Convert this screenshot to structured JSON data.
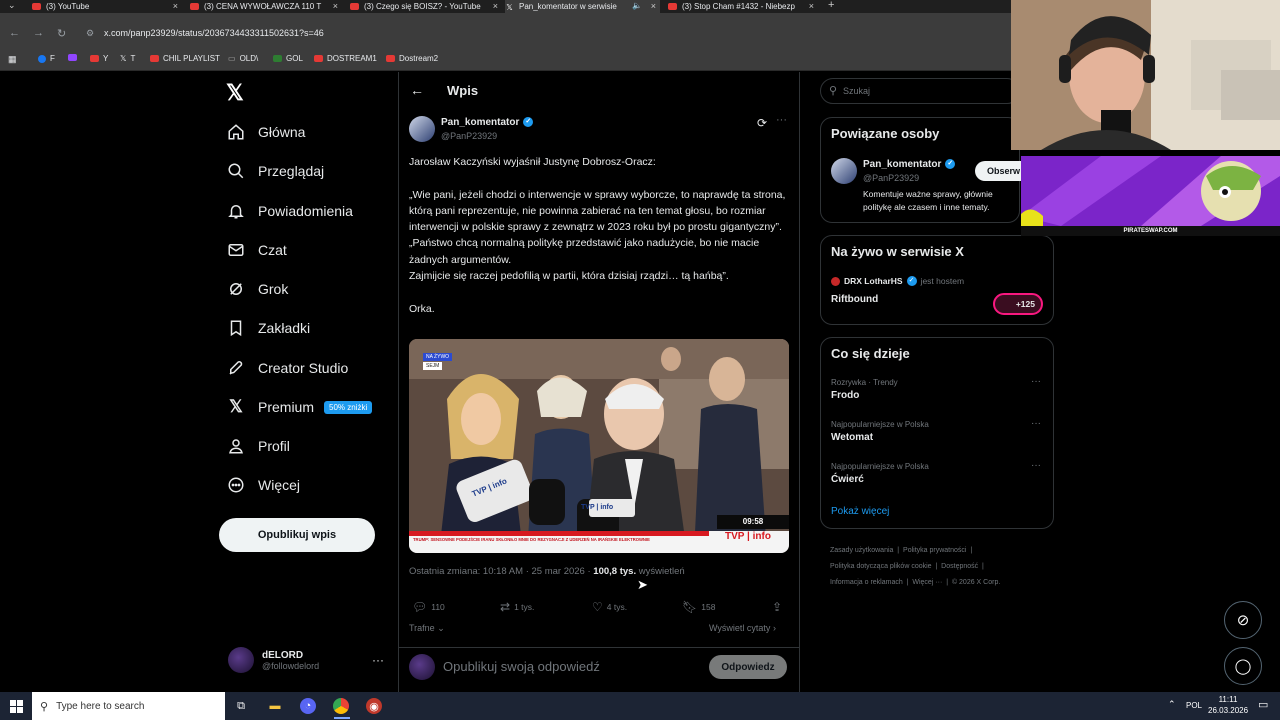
{
  "browser": {
    "tabs": [
      {
        "label": "(3) YouTube",
        "icon": "youtube-icon"
      },
      {
        "label": "(3) CENA WYWOŁAWCZA 110 T",
        "icon": "youtube-icon"
      },
      {
        "label": "(3) Czego się BOISZ? - YouTube",
        "icon": "youtube-icon"
      },
      {
        "label": "Pan_komentator w serwisie",
        "icon": "x-icon"
      },
      {
        "label": "(3) Stop Cham #1432 - Niebezp",
        "icon": "youtube-icon"
      }
    ],
    "url": "x.com/panp23929/status/2036734433311502631?s=46",
    "bookmarks": [
      "F",
      "Y",
      "T",
      "CHIL PLAYLIST",
      "OLD\\",
      "GOL",
      "DOSTREAM1",
      "Dostream2"
    ]
  },
  "nav": {
    "items": [
      "Główna",
      "Przeglądaj",
      "Powiadomienia",
      "Czat",
      "Grok",
      "Zakładki",
      "Creator Studio",
      "Premium",
      "Profil",
      "Więcej"
    ],
    "premium_badge": "50% zniżki",
    "post_button": "Opublikuj wpis",
    "account": {
      "name": "dELORD",
      "handle": "@followdelord"
    }
  },
  "post": {
    "header_title": "Wpis",
    "author_name": "Pan_komentator",
    "author_handle": "@PanP23929",
    "text": "Jarosław Kaczyński wyjaśnił Justynę Dobrosz-Oracz:\n\n„Wie pani, jeżeli chodzi o interwencje w sprawy wyborcze, to naprawdę ta strona, którą pani reprezentuje, nie powinna zabierać na ten temat głosu, bo rozmiar interwencji w polskie sprawy z zewnątrz w 2023 roku był po prostu gigantyczny”.\n„Państwo chcą normalną politykę przedstawić jako nadużycie, bo nie macie żadnych argumentów.\nZajmijcie się raczej pedofilią w partii, która dzisiaj rządzi… tą hańbą”.\n\nOrka.",
    "video": {
      "badge_top": "NA ŻYWO",
      "badge_bottom": "SEJM",
      "mic_label": "TVP | info",
      "time": "09:58",
      "channel": "TVP | info",
      "ticker": "TRUMP: SENSOWNE PODEJŚCIE IRANU SKŁONIŁO MNIE DO REZYGNACJI Z UDERZEŃ NA IRAŃSKIE ELEKTROWNIE"
    },
    "meta_prefix": "Ostatnia zmiana: 10:18 AM · 25 mar 2026 · ",
    "views_count": "100,8 tys.",
    "views_label": " wyświetleń",
    "stats": {
      "replies": "110",
      "reposts": "1 tys.",
      "likes": "4 tys.",
      "bookmarks": "158"
    },
    "sort_label": "Trafne",
    "quotes_label": "Wyświetl cytaty",
    "reply_placeholder": "Opublikuj swoją odpowiedź",
    "reply_button": "Odpowiedz"
  },
  "sidebar": {
    "search_placeholder": "Szukaj",
    "related": {
      "title": "Powiązane osoby",
      "name": "Pan_komentator",
      "handle": "@PanP23929",
      "follow": "Obserw",
      "bio": "Komentuje ważne sprawy, głównie politykę ale czasem i inne tematy."
    },
    "live": {
      "title": "Na żywo w serwisie X",
      "host": "DRX LotharHS",
      "host_suffix": "jest hostem",
      "space": "Riftbound",
      "listeners": "+125"
    },
    "trends": {
      "title": "Co się dzieje",
      "items": [
        {
          "category": "Rozrywka · Trendy",
          "name": "Frodo"
        },
        {
          "category": "Najpopularniejsze w Polska",
          "name": "Wetomat"
        },
        {
          "category": "Najpopularniejsze w Polska",
          "name": "Ćwierć"
        }
      ],
      "show_more": "Pokaż więcej"
    },
    "footer": [
      "Zasady użytkowania",
      "Polityka prywatności",
      "Polityka dotycząca plików cookie",
      "Dostępność",
      "Informacja o reklamach",
      "Więcej ···",
      "© 2026 X Corp."
    ]
  },
  "overlay": {
    "banner_footer": "PIRATESWAP.COM"
  },
  "taskbar": {
    "search_placeholder": "Type here to search",
    "lang": "POL",
    "time": "11:11",
    "date": "26.03.2026"
  },
  "colors": {
    "accent": "#1d9bf0",
    "background": "#000000",
    "muted": "#71767b",
    "youtube": "#e53935"
  }
}
